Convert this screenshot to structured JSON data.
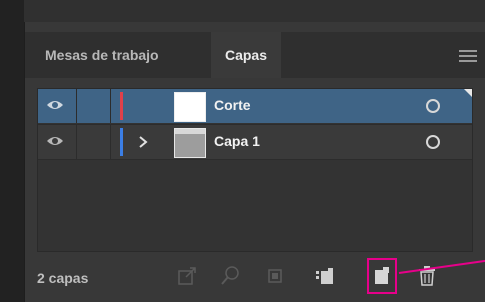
{
  "tabs": [
    {
      "label": "Mesas de trabajo"
    },
    {
      "label": "Capas"
    }
  ],
  "layers": [
    {
      "name": "Corte",
      "color": "#e0404a",
      "selected": true,
      "expandable": false
    },
    {
      "name": "Capa 1",
      "color": "#3b7ee5",
      "selected": false,
      "expandable": true
    }
  ],
  "footer": {
    "count": "2 capas"
  },
  "colors": {
    "selection": "#3f6486",
    "highlight": "#e6008a"
  },
  "icons": {
    "footer": [
      "export-icon",
      "search-icon",
      "clip-mask-icon",
      "new-sublayer-icon",
      "new-layer-icon",
      "trash-icon"
    ]
  }
}
